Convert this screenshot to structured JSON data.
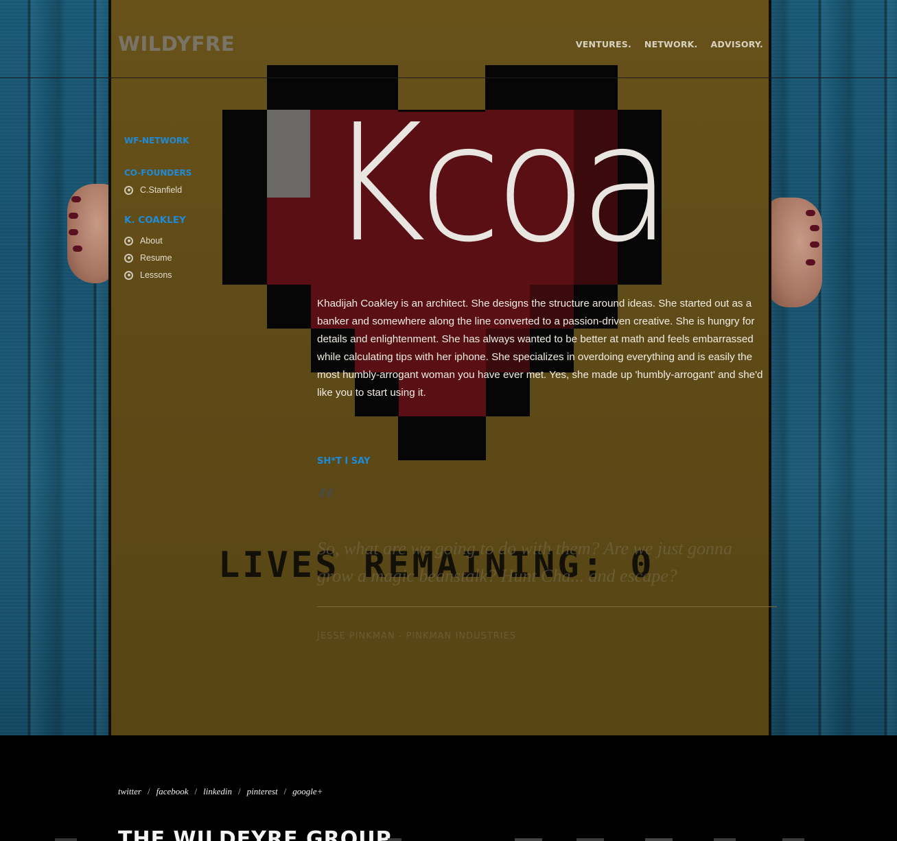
{
  "header": {
    "logo": "WILDYFRE",
    "nav": [
      "VENTURES.",
      "NETWORK.",
      "ADVISORY."
    ]
  },
  "sidebar": {
    "network_heading": "WF-NETWORK",
    "cofounders_heading": "CO-FOUNDERS",
    "cofounders": [
      "C.Stanfield"
    ],
    "person_heading": "K. COAKLEY",
    "person_links": [
      "About",
      "Resume",
      "Lessons"
    ]
  },
  "profile": {
    "name_display": "Kcoa",
    "bio": "Khadijah Coakley is an architect. She designs the structure around ideas. She started out as a banker and somewhere along the line converted to a passion-driven creative. She is hungry for details and enlightenment. She has always wanted to be better at math and feels embarrassed while calculating tips with her iphone. She specializes in overdoing everything and is easily the most humbly-arrogant woman you have ever met. Yes, she made up 'humbly-arrogant' and she'd like you to start using it."
  },
  "quote": {
    "heading": "SH*T I SAY",
    "mark": "“",
    "text": "So, what are we going to do with them? Are we just gonna grow a magic beanstalk? Hunt Cha... and escape?",
    "author": "JESSE PINKMAN - PINKMAN INDUSTRIES"
  },
  "poster": {
    "lives_text": "LIVES REMAINING: 0"
  },
  "footer": {
    "social": [
      "twitter",
      "facebook",
      "linkedin",
      "pinterest",
      "google+"
    ],
    "separator": "/",
    "group_title": "THE WILDEYRE GROUP"
  },
  "colors": {
    "accent_blue": "#1f8bd8",
    "poster_yellow": "#5e4a17",
    "heart_red": "#5a0f14",
    "wall_blue": "#17526f"
  }
}
